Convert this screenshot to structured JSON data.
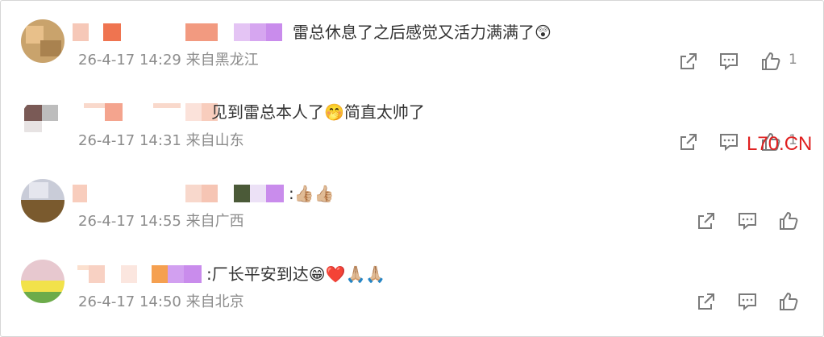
{
  "comments": [
    {
      "text_fragment": "雷总休息了之后感觉又活力满满了",
      "emoji": "😲",
      "timestamp": "26-4-17 14:29",
      "location": "来自黑龙江",
      "like_count": "1",
      "icons": [
        "share-icon",
        "comment-icon",
        "like-icon"
      ]
    },
    {
      "text_fragment": "见到雷总本人了",
      "emoji_mid": "🤭",
      "text_after": "简直太帅了",
      "timestamp": "26-4-17 14:31",
      "location": "来自山东",
      "like_count": "1",
      "icons": [
        "share-icon",
        "comment-icon",
        "like-icon"
      ]
    },
    {
      "text_fragment": ":",
      "emoji": "👍🏼👍🏼",
      "timestamp": "26-4-17 14:55",
      "location": "来自广西",
      "icons": [
        "share-icon",
        "comment-icon",
        "like-icon"
      ]
    },
    {
      "text_fragment": ":厂长平安到达",
      "emoji": "😁❤️🙏🏼🙏🏼",
      "timestamp": "26-4-17 14:50",
      "location": "来自北京",
      "icons": [
        "share-icon",
        "comment-icon",
        "like-icon"
      ]
    }
  ],
  "watermark": "L70.CN",
  "colors": {
    "meta_gray": "#8c8c8c",
    "icon_gray": "#7a7a7a",
    "watermark_red": "#e02020",
    "text": "#333333"
  }
}
